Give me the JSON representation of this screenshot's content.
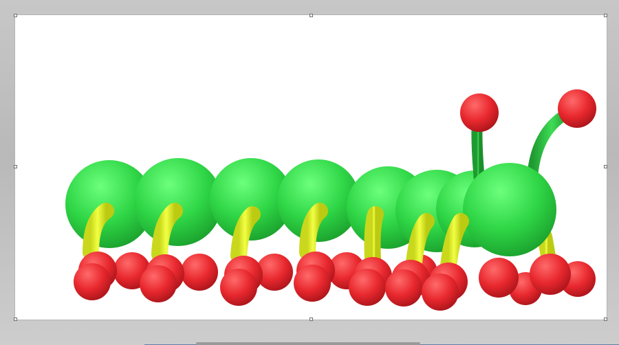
{
  "canvas": {
    "image_name": "caterpillar-3d-model",
    "colors": {
      "body_green": "#2ecc40",
      "leg_yellow": "#e4f22a",
      "foot_red": "#e8282e",
      "background": "#ffffff"
    }
  },
  "selection": {
    "handles": [
      "top-left",
      "top-center",
      "top-right",
      "middle-left",
      "middle-right",
      "bottom-left",
      "bottom-center",
      "bottom-right"
    ]
  },
  "scrollbar": {
    "orientation": "horizontal"
  }
}
